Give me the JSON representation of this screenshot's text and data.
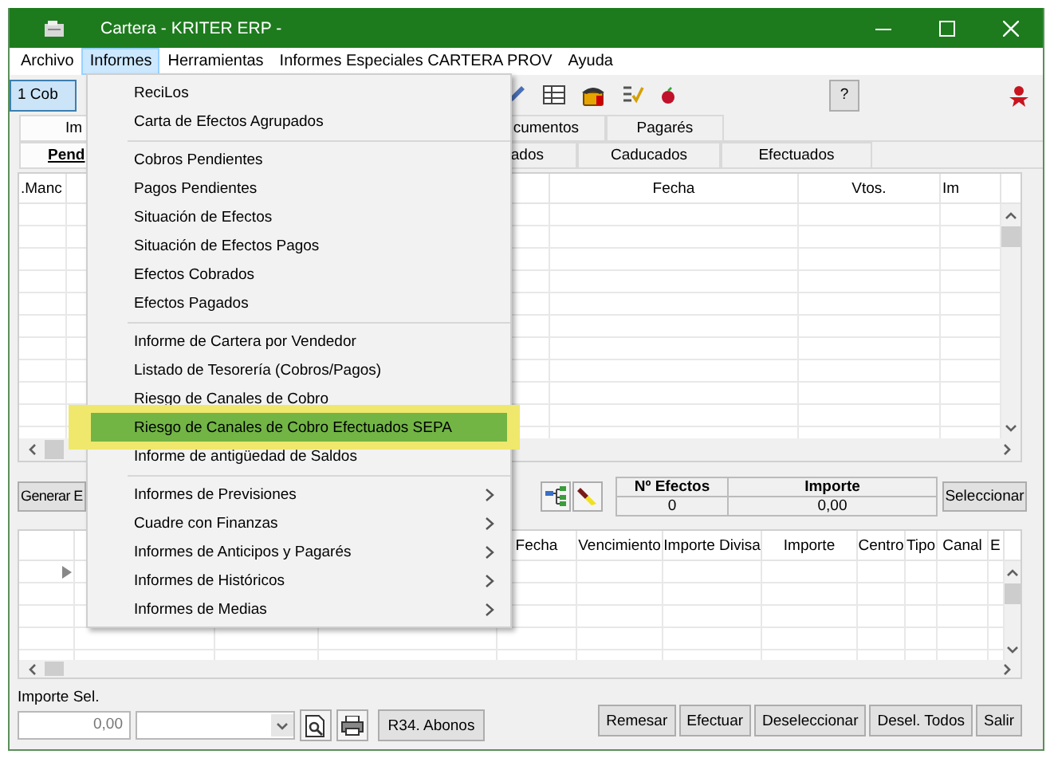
{
  "window": {
    "title": "Cartera - KRITER ERP -"
  },
  "menu_bar": [
    {
      "label": "Archivo",
      "selected": false
    },
    {
      "label": "Informes",
      "selected": true
    },
    {
      "label": "Herramientas",
      "selected": false
    },
    {
      "label": "Informes Especiales CARTERA PROV",
      "selected": false
    },
    {
      "label": "Ayuda",
      "selected": false
    }
  ],
  "toolbar": {
    "first_button": "1 Cob",
    "help_button": "?"
  },
  "tabs_top": [
    {
      "label": "Im",
      "selected": true
    },
    {
      "label": "cumentos",
      "selected": false
    },
    {
      "label": "Pagarés",
      "selected": false
    }
  ],
  "tabs_bottom": [
    {
      "label": "Pend",
      "selected": true
    },
    {
      "label": "ados",
      "selected": false
    },
    {
      "label": "Caducados",
      "selected": false
    },
    {
      "label": "Efectuados",
      "selected": false
    }
  ],
  "upper_table": {
    "columns": [
      ".Manc",
      "Fecha",
      "Vtos.",
      "Im"
    ]
  },
  "summary": {
    "generate_button": "Generar E",
    "count_label": "Nº Efectos",
    "count": "0",
    "amount_label": "Importe",
    "amount": "0,00",
    "select_button": "Seleccionar"
  },
  "lower_table": {
    "columns": [
      "Fecha",
      "Vencimiento",
      "Importe Divisa",
      "Importe",
      "Centro",
      "Tipo",
      "Canal",
      "E"
    ]
  },
  "footer": {
    "label": "Importe Sel.",
    "value": "0,00",
    "report_button": "R34. Abonos",
    "buttons": [
      "Remesar",
      "Efectuar",
      "Deseleccionar",
      "Desel. Todos",
      "Salir"
    ]
  },
  "informes_menu": {
    "items": [
      {
        "kind": "item",
        "label": "ReciLos",
        "selected": false,
        "submenu": false
      },
      {
        "kind": "item",
        "label": "Carta de Efectos Agrupados",
        "selected": false,
        "submenu": false
      },
      {
        "kind": "separator"
      },
      {
        "kind": "item",
        "label": "Cobros Pendientes",
        "selected": false,
        "submenu": false
      },
      {
        "kind": "item",
        "label": "Pagos Pendientes",
        "selected": false,
        "submenu": false
      },
      {
        "kind": "item",
        "label": "Situación de Efectos",
        "selected": false,
        "submenu": false
      },
      {
        "kind": "item",
        "label": "Situación de Efectos Pagos",
        "selected": false,
        "submenu": false
      },
      {
        "kind": "item",
        "label": "Efectos Cobrados",
        "selected": false,
        "submenu": false
      },
      {
        "kind": "item",
        "label": "Efectos Pagados",
        "selected": false,
        "submenu": false
      },
      {
        "kind": "separator"
      },
      {
        "kind": "item",
        "label": "Informe de Cartera por Vendedor",
        "selected": false,
        "submenu": false
      },
      {
        "kind": "item",
        "label": "Listado de Tesorería (Cobros/Pagos)",
        "selected": false,
        "submenu": false
      },
      {
        "kind": "item",
        "label": "Riesgo de Canales de Cobro",
        "selected": false,
        "submenu": false
      },
      {
        "kind": "item",
        "label": "Riesgo de Canales de Cobro Efectuados SEPA",
        "selected": true,
        "submenu": false
      },
      {
        "kind": "item",
        "label": "Informe de antigüedad de Saldos",
        "selected": false,
        "submenu": false
      },
      {
        "kind": "separator"
      },
      {
        "kind": "item",
        "label": "Informes de Previsiones",
        "selected": false,
        "submenu": true
      },
      {
        "kind": "item",
        "label": "Cuadre con Finanzas",
        "selected": false,
        "submenu": true
      },
      {
        "kind": "item",
        "label": "Informes de Anticipos y Pagarés",
        "selected": false,
        "submenu": true
      },
      {
        "kind": "item",
        "label": "Informes de Históricos",
        "selected": false,
        "submenu": true
      },
      {
        "kind": "item",
        "label": "Informes de Medias",
        "selected": false,
        "submenu": true
      }
    ]
  }
}
